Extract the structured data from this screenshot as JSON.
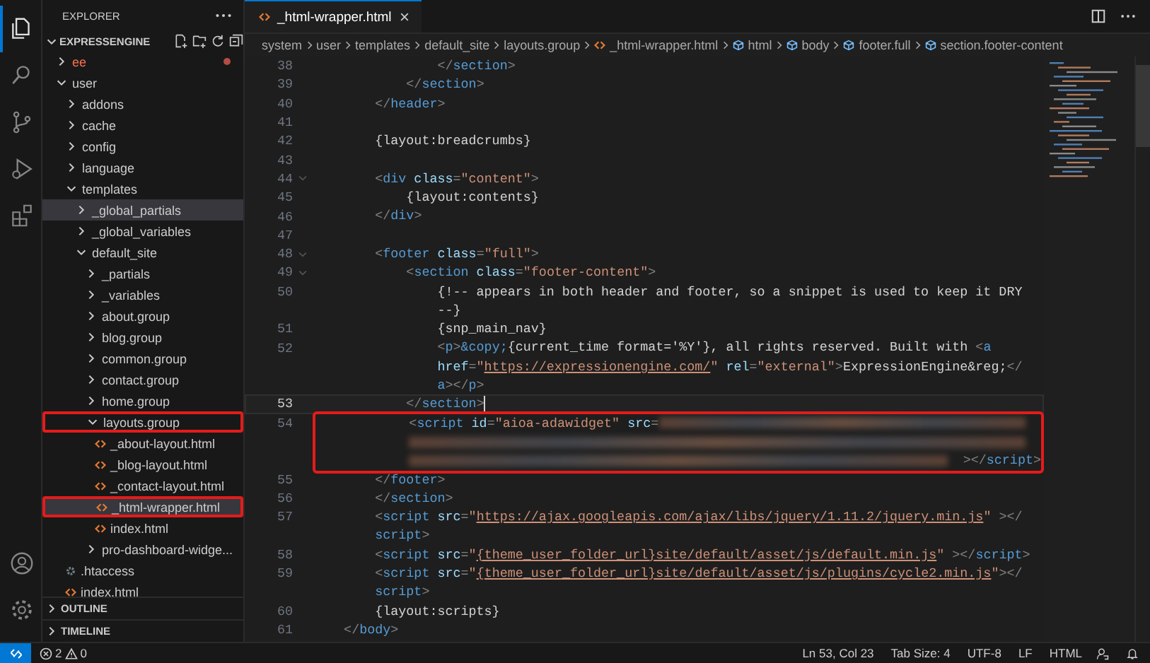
{
  "activity_bar": {
    "items": [
      {
        "kind": "files",
        "selected": true
      },
      {
        "kind": "search",
        "selected": false
      },
      {
        "kind": "source_control",
        "selected": false
      },
      {
        "kind": "run_debug",
        "selected": false
      },
      {
        "kind": "extensions",
        "selected": false
      }
    ],
    "bottom": [
      {
        "kind": "account"
      },
      {
        "kind": "settings"
      }
    ]
  },
  "explorer": {
    "title": "EXPLORER",
    "workspace": {
      "name": "EXPRESSENGINE",
      "expanded": true
    },
    "tree": [
      {
        "name": "ee",
        "kind": "folder",
        "expanded": false,
        "selected": false,
        "outlined": false,
        "error": true
      },
      {
        "name": "user",
        "kind": "folder",
        "expanded": true,
        "selected": false,
        "outlined": false,
        "error": false,
        "children": [
          {
            "name": "addons",
            "kind": "folder",
            "expanded": false,
            "selected": false,
            "outlined": false,
            "error": false
          },
          {
            "name": "cache",
            "kind": "folder",
            "expanded": false,
            "selected": false,
            "outlined": false,
            "error": false
          },
          {
            "name": "config",
            "kind": "folder",
            "expanded": false,
            "selected": false,
            "outlined": false,
            "error": false
          },
          {
            "name": "language",
            "kind": "folder",
            "expanded": false,
            "selected": false,
            "outlined": false,
            "error": false
          },
          {
            "name": "templates",
            "kind": "folder",
            "expanded": true,
            "selected": false,
            "outlined": false,
            "error": false,
            "children": [
              {
                "name": "_global_partials",
                "kind": "folder",
                "expanded": false,
                "selected": true,
                "outlined": false,
                "error": false
              },
              {
                "name": "_global_variables",
                "kind": "folder",
                "expanded": false,
                "selected": false,
                "outlined": false,
                "error": false
              },
              {
                "name": "default_site",
                "kind": "folder",
                "expanded": true,
                "selected": false,
                "outlined": false,
                "error": false,
                "children": [
                  {
                    "name": "_partials",
                    "kind": "folder",
                    "expanded": false,
                    "selected": false,
                    "outlined": false,
                    "error": false
                  },
                  {
                    "name": "_variables",
                    "kind": "folder",
                    "expanded": false,
                    "selected": false,
                    "outlined": false,
                    "error": false
                  },
                  {
                    "name": "about.group",
                    "kind": "folder",
                    "expanded": false,
                    "selected": false,
                    "outlined": false,
                    "error": false
                  },
                  {
                    "name": "blog.group",
                    "kind": "folder",
                    "expanded": false,
                    "selected": false,
                    "outlined": false,
                    "error": false
                  },
                  {
                    "name": "common.group",
                    "kind": "folder",
                    "expanded": false,
                    "selected": false,
                    "outlined": false,
                    "error": false
                  },
                  {
                    "name": "contact.group",
                    "kind": "folder",
                    "expanded": false,
                    "selected": false,
                    "outlined": false,
                    "error": false
                  },
                  {
                    "name": "home.group",
                    "kind": "folder",
                    "expanded": false,
                    "selected": false,
                    "outlined": false,
                    "error": false
                  },
                  {
                    "name": "layouts.group",
                    "kind": "folder",
                    "expanded": true,
                    "selected": false,
                    "outlined": true,
                    "error": false,
                    "children": [
                      {
                        "name": "_about-layout.html",
                        "kind": "html",
                        "selected": false,
                        "outlined": false,
                        "error": false
                      },
                      {
                        "name": "_blog-layout.html",
                        "kind": "html",
                        "selected": false,
                        "outlined": false,
                        "error": false
                      },
                      {
                        "name": "_contact-layout.html",
                        "kind": "html",
                        "selected": false,
                        "outlined": false,
                        "error": false
                      },
                      {
                        "name": "_html-wrapper.html",
                        "kind": "html",
                        "selected": true,
                        "outlined": true,
                        "error": false
                      },
                      {
                        "name": "index.html",
                        "kind": "html",
                        "selected": false,
                        "outlined": false,
                        "error": false
                      }
                    ]
                  },
                  {
                    "name": "pro-dashboard-widge...",
                    "kind": "folder",
                    "expanded": false,
                    "selected": false,
                    "outlined": false,
                    "error": false
                  }
                ]
              }
            ]
          },
          {
            "name": ".htaccess",
            "kind": "config",
            "selected": false,
            "outlined": false,
            "error": false
          },
          {
            "name": "index.html",
            "kind": "html",
            "selected": false,
            "outlined": false,
            "error": false
          }
        ]
      }
    ],
    "sections": [
      {
        "label": "OUTLINE",
        "expanded": false
      },
      {
        "label": "TIMELINE",
        "expanded": false
      }
    ]
  },
  "editor": {
    "tabs": [
      {
        "label": "_html-wrapper.html",
        "selected": true
      }
    ],
    "breadcrumbs": [
      {
        "label": "system",
        "kind": "folder"
      },
      {
        "label": "user",
        "kind": "folder"
      },
      {
        "label": "templates",
        "kind": "folder"
      },
      {
        "label": "default_site",
        "kind": "folder"
      },
      {
        "label": "layouts.group",
        "kind": "folder"
      },
      {
        "label": "_html-wrapper.html",
        "kind": "html"
      },
      {
        "label": "html",
        "kind": "element"
      },
      {
        "label": "body",
        "kind": "element"
      },
      {
        "label": "footer.full",
        "kind": "element"
      },
      {
        "label": "section.footer-content",
        "kind": "element"
      }
    ],
    "lines": [
      {
        "n": "38",
        "foldable": false,
        "current": false,
        "outlined": false,
        "rows": [
          {
            "tokens": [
              {
                "kind": "punct",
                "text": "                </"
              },
              {
                "kind": "tag",
                "text": "section"
              },
              {
                "kind": "punct",
                "text": ">"
              }
            ]
          }
        ]
      },
      {
        "n": "39",
        "foldable": false,
        "current": false,
        "outlined": false,
        "rows": [
          {
            "tokens": [
              {
                "kind": "punct",
                "text": "            </"
              },
              {
                "kind": "tag",
                "text": "section"
              },
              {
                "kind": "punct",
                "text": ">"
              }
            ]
          }
        ]
      },
      {
        "n": "40",
        "foldable": false,
        "current": false,
        "outlined": false,
        "rows": [
          {
            "tokens": [
              {
                "kind": "punct",
                "text": "        </"
              },
              {
                "kind": "tag",
                "text": "header"
              },
              {
                "kind": "punct",
                "text": ">"
              }
            ]
          }
        ]
      },
      {
        "n": "41",
        "foldable": false,
        "current": false,
        "outlined": false,
        "rows": [
          {}
        ]
      },
      {
        "n": "42",
        "foldable": false,
        "current": false,
        "outlined": false,
        "rows": [
          {
            "tokens": [
              {
                "kind": "text",
                "text": "        {layout:breadcrumbs}"
              }
            ]
          }
        ]
      },
      {
        "n": "43",
        "foldable": false,
        "current": false,
        "outlined": false,
        "rows": [
          {}
        ]
      },
      {
        "n": "44",
        "foldable": true,
        "current": false,
        "outlined": false,
        "rows": [
          {
            "tokens": [
              {
                "kind": "punct",
                "text": "        <"
              },
              {
                "kind": "tag",
                "text": "div"
              },
              {
                "kind": "attr",
                "text": " class"
              },
              {
                "kind": "punct",
                "text": "="
              },
              {
                "kind": "string",
                "text": "\"content\""
              },
              {
                "kind": "punct",
                "text": ">"
              }
            ]
          }
        ]
      },
      {
        "n": "45",
        "foldable": false,
        "current": false,
        "outlined": false,
        "rows": [
          {
            "tokens": [
              {
                "kind": "text",
                "text": "            {layout:contents}"
              }
            ]
          }
        ]
      },
      {
        "n": "46",
        "foldable": false,
        "current": false,
        "outlined": false,
        "rows": [
          {
            "tokens": [
              {
                "kind": "punct",
                "text": "        </"
              },
              {
                "kind": "tag",
                "text": "div"
              },
              {
                "kind": "punct",
                "text": ">"
              }
            ]
          }
        ]
      },
      {
        "n": "47",
        "foldable": false,
        "current": false,
        "outlined": false,
        "rows": [
          {}
        ]
      },
      {
        "n": "48",
        "foldable": true,
        "current": false,
        "outlined": false,
        "rows": [
          {
            "tokens": [
              {
                "kind": "punct",
                "text": "        <"
              },
              {
                "kind": "tag",
                "text": "footer"
              },
              {
                "kind": "attr",
                "text": " class"
              },
              {
                "kind": "punct",
                "text": "="
              },
              {
                "kind": "string",
                "text": "\"full\""
              },
              {
                "kind": "punct",
                "text": ">"
              }
            ]
          }
        ]
      },
      {
        "n": "49",
        "foldable": true,
        "current": false,
        "outlined": false,
        "rows": [
          {
            "tokens": [
              {
                "kind": "punct",
                "text": "            <"
              },
              {
                "kind": "tag",
                "text": "section"
              },
              {
                "kind": "attr",
                "text": " class"
              },
              {
                "kind": "punct",
                "text": "="
              },
              {
                "kind": "string",
                "text": "\"footer-content\""
              },
              {
                "kind": "punct",
                "text": ">"
              }
            ]
          }
        ]
      },
      {
        "n": "50",
        "foldable": false,
        "current": false,
        "outlined": false,
        "rows": [
          {
            "tokens": [
              {
                "kind": "text",
                "text": "                {!-- appears in both header and footer, so a snippet is used to keep it DRY"
              }
            ]
          },
          {
            "tokens": [
              {
                "kind": "text",
                "text": "--}"
              }
            ]
          }
        ]
      },
      {
        "n": "51",
        "foldable": false,
        "current": false,
        "outlined": false,
        "rows": [
          {
            "tokens": [
              {
                "kind": "text",
                "text": "                {snp_main_nav}"
              }
            ]
          }
        ]
      },
      {
        "n": "52",
        "foldable": false,
        "current": false,
        "outlined": false,
        "rows": [
          {
            "tokens": [
              {
                "kind": "punct",
                "text": "                <"
              },
              {
                "kind": "tag",
                "text": "p"
              },
              {
                "kind": "punct",
                "text": ">"
              },
              {
                "kind": "entity",
                "text": "&copy;"
              },
              {
                "kind": "text",
                "text": "{current_time format='%Y'}, all rights reserved. Built with "
              },
              {
                "kind": "punct",
                "text": "<"
              },
              {
                "kind": "tag",
                "text": "a"
              }
            ]
          },
          {
            "tokens": [
              {
                "kind": "attr",
                "text": "href"
              },
              {
                "kind": "punct",
                "text": "="
              },
              {
                "kind": "string",
                "text": "\""
              },
              {
                "kind": "link",
                "text": "https://expressionengine.com/"
              },
              {
                "kind": "string",
                "text": "\""
              },
              {
                "kind": "attr",
                "text": " rel"
              },
              {
                "kind": "punct",
                "text": "="
              },
              {
                "kind": "string",
                "text": "\"external\""
              },
              {
                "kind": "punct",
                "text": ">"
              },
              {
                "kind": "text",
                "text": "ExpressionEngine&reg;"
              },
              {
                "kind": "punct",
                "text": "</"
              }
            ]
          },
          {
            "tokens": [
              {
                "kind": "tag",
                "text": "a"
              },
              {
                "kind": "punct",
                "text": ">"
              },
              {
                "kind": "punct",
                "text": "</"
              },
              {
                "kind": "tag",
                "text": "p"
              },
              {
                "kind": "punct",
                "text": ">"
              }
            ]
          }
        ]
      },
      {
        "n": "53",
        "foldable": false,
        "current": true,
        "outlined": false,
        "rows": [
          {
            "tokens": [
              {
                "kind": "punct",
                "text": "            </"
              },
              {
                "kind": "tag",
                "text": "section"
              },
              {
                "kind": "punct",
                "text": ">"
              }
            ]
          }
        ]
      },
      {
        "n": "54",
        "foldable": false,
        "current": false,
        "outlined": true,
        "rows": [
          {
            "tokens": [
              {
                "kind": "punct",
                "text": "            <"
              },
              {
                "kind": "tag",
                "text": "script"
              },
              {
                "kind": "attr",
                "text": " id"
              },
              {
                "kind": "punct",
                "text": "="
              },
              {
                "kind": "string",
                "text": "\"aioa-adawidget\""
              },
              {
                "kind": "attr",
                "text": " src"
              },
              {
                "kind": "punct",
                "text": "="
              },
              {
                "kind": "blur"
              }
            ]
          },
          {
            "tokens": [
              {
                "kind": "blur"
              }
            ]
          },
          {
            "tokens": [
              {
                "kind": "blur"
              },
              {
                "kind": "punct",
                "text": "></"
              },
              {
                "kind": "tag",
                "text": "script"
              },
              {
                "kind": "punct",
                "text": ">"
              }
            ]
          }
        ]
      },
      {
        "n": "55",
        "foldable": false,
        "current": false,
        "outlined": false,
        "rows": [
          {
            "tokens": [
              {
                "kind": "punct",
                "text": "        </"
              },
              {
                "kind": "tag",
                "text": "footer"
              },
              {
                "kind": "punct",
                "text": ">"
              }
            ]
          }
        ]
      },
      {
        "n": "56",
        "foldable": false,
        "current": false,
        "outlined": false,
        "rows": [
          {
            "tokens": [
              {
                "kind": "punct",
                "text": "        </"
              },
              {
                "kind": "tag",
                "text": "section"
              },
              {
                "kind": "punct",
                "text": ">"
              }
            ]
          }
        ]
      },
      {
        "n": "57",
        "foldable": false,
        "current": false,
        "outlined": false,
        "rows": [
          {
            "tokens": [
              {
                "kind": "punct",
                "text": "        <"
              },
              {
                "kind": "tag",
                "text": "script"
              },
              {
                "kind": "attr",
                "text": " src"
              },
              {
                "kind": "punct",
                "text": "="
              },
              {
                "kind": "string",
                "text": "\""
              },
              {
                "kind": "link",
                "text": "https://ajax.googleapis.com/ajax/libs/jquery/1.11.2/jquery.min.js"
              },
              {
                "kind": "string",
                "text": "\""
              },
              {
                "kind": "punct",
                "text": " ></"
              }
            ]
          },
          {
            "tokens": [
              {
                "kind": "tag",
                "text": "script"
              },
              {
                "kind": "punct",
                "text": ">"
              }
            ]
          }
        ]
      },
      {
        "n": "58",
        "foldable": false,
        "current": false,
        "outlined": false,
        "rows": [
          {
            "tokens": [
              {
                "kind": "punct",
                "text": "        <"
              },
              {
                "kind": "tag",
                "text": "script"
              },
              {
                "kind": "attr",
                "text": " src"
              },
              {
                "kind": "punct",
                "text": "="
              },
              {
                "kind": "string",
                "text": "\""
              },
              {
                "kind": "link",
                "text": "{theme_user_folder_url}site/default/asset/js/default.min.js"
              },
              {
                "kind": "string",
                "text": "\""
              },
              {
                "kind": "punct",
                "text": " ></"
              },
              {
                "kind": "tag",
                "text": "script"
              },
              {
                "kind": "punct",
                "text": ">"
              }
            ]
          }
        ]
      },
      {
        "n": "59",
        "foldable": false,
        "current": false,
        "outlined": false,
        "rows": [
          {
            "tokens": [
              {
                "kind": "punct",
                "text": "        <"
              },
              {
                "kind": "tag",
                "text": "script"
              },
              {
                "kind": "attr",
                "text": " src"
              },
              {
                "kind": "punct",
                "text": "="
              },
              {
                "kind": "string",
                "text": "\""
              },
              {
                "kind": "link",
                "text": "{theme_user_folder_url}site/default/asset/js/plugins/cycle2.min.js"
              },
              {
                "kind": "string",
                "text": "\""
              },
              {
                "kind": "punct",
                "text": "></"
              }
            ]
          },
          {
            "tokens": [
              {
                "kind": "tag",
                "text": "script"
              },
              {
                "kind": "punct",
                "text": ">"
              }
            ]
          }
        ]
      },
      {
        "n": "60",
        "foldable": false,
        "current": false,
        "outlined": false,
        "rows": [
          {
            "tokens": [
              {
                "kind": "text",
                "text": "        {layout:scripts}"
              }
            ]
          }
        ]
      },
      {
        "n": "61",
        "foldable": false,
        "current": false,
        "outlined": false,
        "rows": [
          {
            "tokens": [
              {
                "kind": "punct",
                "text": "    </"
              },
              {
                "kind": "tag",
                "text": "body"
              },
              {
                "kind": "punct",
                "text": ">"
              }
            ]
          }
        ]
      }
    ]
  },
  "status_bar": {
    "errors": "2",
    "warnings": "0",
    "items": [
      "Ln 53, Col 23",
      "Tab Size: 4",
      "UTF-8",
      "LF",
      "HTML"
    ]
  }
}
